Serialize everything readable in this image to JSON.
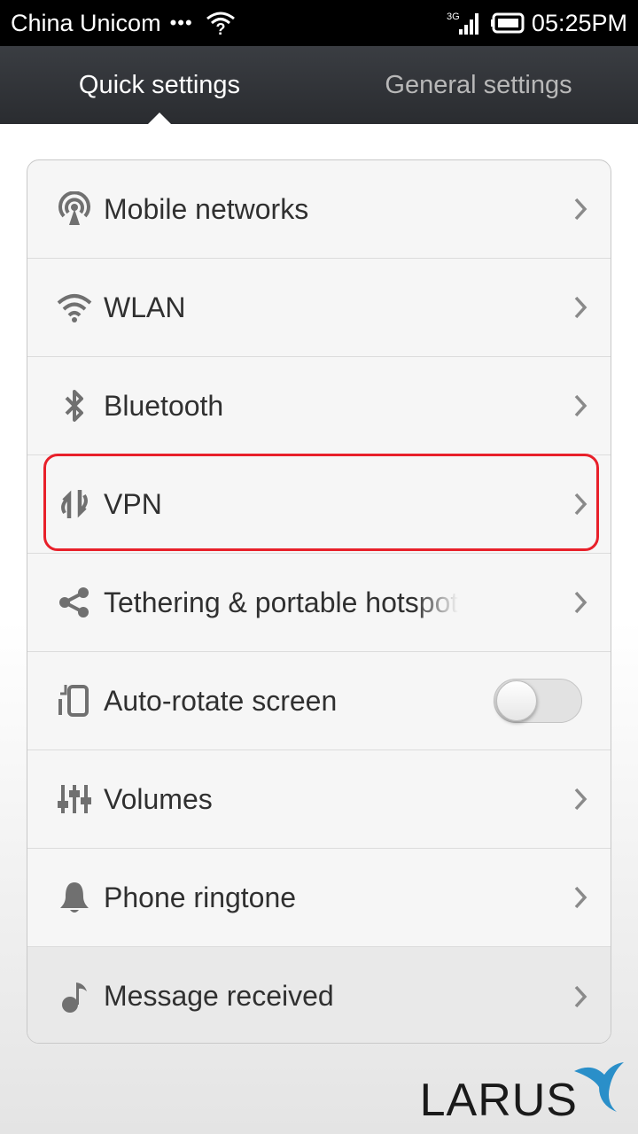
{
  "status_bar": {
    "carrier": "China Unicom",
    "dots": "•••",
    "network_type": "3G",
    "time": "05:25PM"
  },
  "tabs": [
    {
      "label": "Quick settings",
      "active": true
    },
    {
      "label": "General settings",
      "active": false
    }
  ],
  "settings": [
    {
      "label": "Mobile networks",
      "icon": "antenna-icon",
      "control": "chevron"
    },
    {
      "label": "WLAN",
      "icon": "wifi-icon",
      "control": "chevron"
    },
    {
      "label": "Bluetooth",
      "icon": "bluetooth-icon",
      "control": "chevron"
    },
    {
      "label": "VPN",
      "icon": "vpn-icon",
      "control": "chevron",
      "highlighted": true
    },
    {
      "label": "Tethering & portable hotspot",
      "icon": "share-icon",
      "control": "chevron"
    },
    {
      "label": "Auto-rotate screen",
      "icon": "rotate-icon",
      "control": "toggle",
      "toggle_on": false
    },
    {
      "label": "Volumes",
      "icon": "sliders-icon",
      "control": "chevron"
    },
    {
      "label": "Phone ringtone",
      "icon": "bell-icon",
      "control": "chevron"
    },
    {
      "label": "Message received",
      "icon": "music-note-icon",
      "control": "chevron"
    }
  ],
  "watermark": {
    "text": "LARUS"
  },
  "colors": {
    "header_bg": "#2f3136",
    "highlight": "#e8202a",
    "icon_gray": "#707070",
    "brand_blue": "#2a8fc9"
  }
}
